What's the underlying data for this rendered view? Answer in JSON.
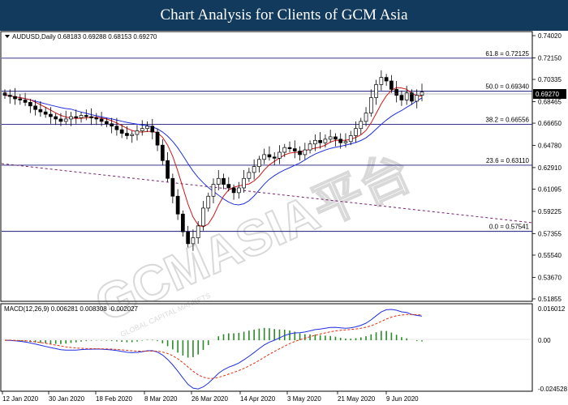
{
  "banner": {
    "title": "Chart Analysis for Clients of GCM Asia"
  },
  "main_panel": {
    "symbol_line": "AUDUSD,Daily  0.68183 0.69288 0.68153 0.69270",
    "current_price": "0.69270",
    "price_ticks": [
      "0.74020",
      "0.72150",
      "0.70335",
      "0.68465",
      "0.66650",
      "0.64780",
      "0.62910",
      "0.61095",
      "0.59225",
      "0.57355",
      "0.55540",
      "0.53670",
      "0.51855"
    ],
    "fib_levels": [
      {
        "label": "61.8 = 0.72125",
        "value": 0.72125
      },
      {
        "label": "50.0 = 0.69340",
        "value": 0.6934
      },
      {
        "label": "38.2 = 0.66556",
        "value": 0.66556
      },
      {
        "label": "23.6 = 0.63110",
        "value": 0.6311
      },
      {
        "label": "0.0 = 0.57541",
        "value": 0.57541
      }
    ],
    "watermark": "GCMASIA平台",
    "watermark_sub": "GLOBAL CAPITAL MARKETS"
  },
  "macd_panel": {
    "header": "MACD(12,26,9) 0.006281 0.008308 -0.002027",
    "ticks": [
      "0.016012",
      "0.00",
      "-0.024528"
    ]
  },
  "x_axis": {
    "labels": [
      "12 Jan 2020",
      "30 Jan 2020",
      "18 Feb 2020",
      "8 Mar 2020",
      "26 Mar 2020",
      "14 Apr 2020",
      "3 May 2020",
      "21 May 2020",
      "9 Jun 2020"
    ]
  },
  "chart_data": {
    "type": "candlestick",
    "price_range": [
      0.51855,
      0.7402
    ],
    "close_series_approx": [
      0.69,
      0.689,
      0.687,
      0.686,
      0.684,
      0.681,
      0.678,
      0.676,
      0.674,
      0.672,
      0.67,
      0.668,
      0.67,
      0.672,
      0.671,
      0.673,
      0.672,
      0.671,
      0.67,
      0.668,
      0.666,
      0.664,
      0.661,
      0.658,
      0.656,
      0.657,
      0.66,
      0.662,
      0.664,
      0.659,
      0.648,
      0.635,
      0.62,
      0.605,
      0.59,
      0.575,
      0.565,
      0.57,
      0.58,
      0.595,
      0.605,
      0.615,
      0.62,
      0.615,
      0.612,
      0.608,
      0.612,
      0.62,
      0.625,
      0.63,
      0.636,
      0.64,
      0.638,
      0.637,
      0.642,
      0.646,
      0.645,
      0.643,
      0.64,
      0.644,
      0.649,
      0.652,
      0.65,
      0.653,
      0.655,
      0.653,
      0.65,
      0.651,
      0.656,
      0.662,
      0.668,
      0.675,
      0.688,
      0.699,
      0.705,
      0.702,
      0.695,
      0.69,
      0.686,
      0.692,
      0.685,
      0.69,
      0.6927
    ],
    "macd_range": [
      -0.024528,
      0.016012
    ]
  }
}
